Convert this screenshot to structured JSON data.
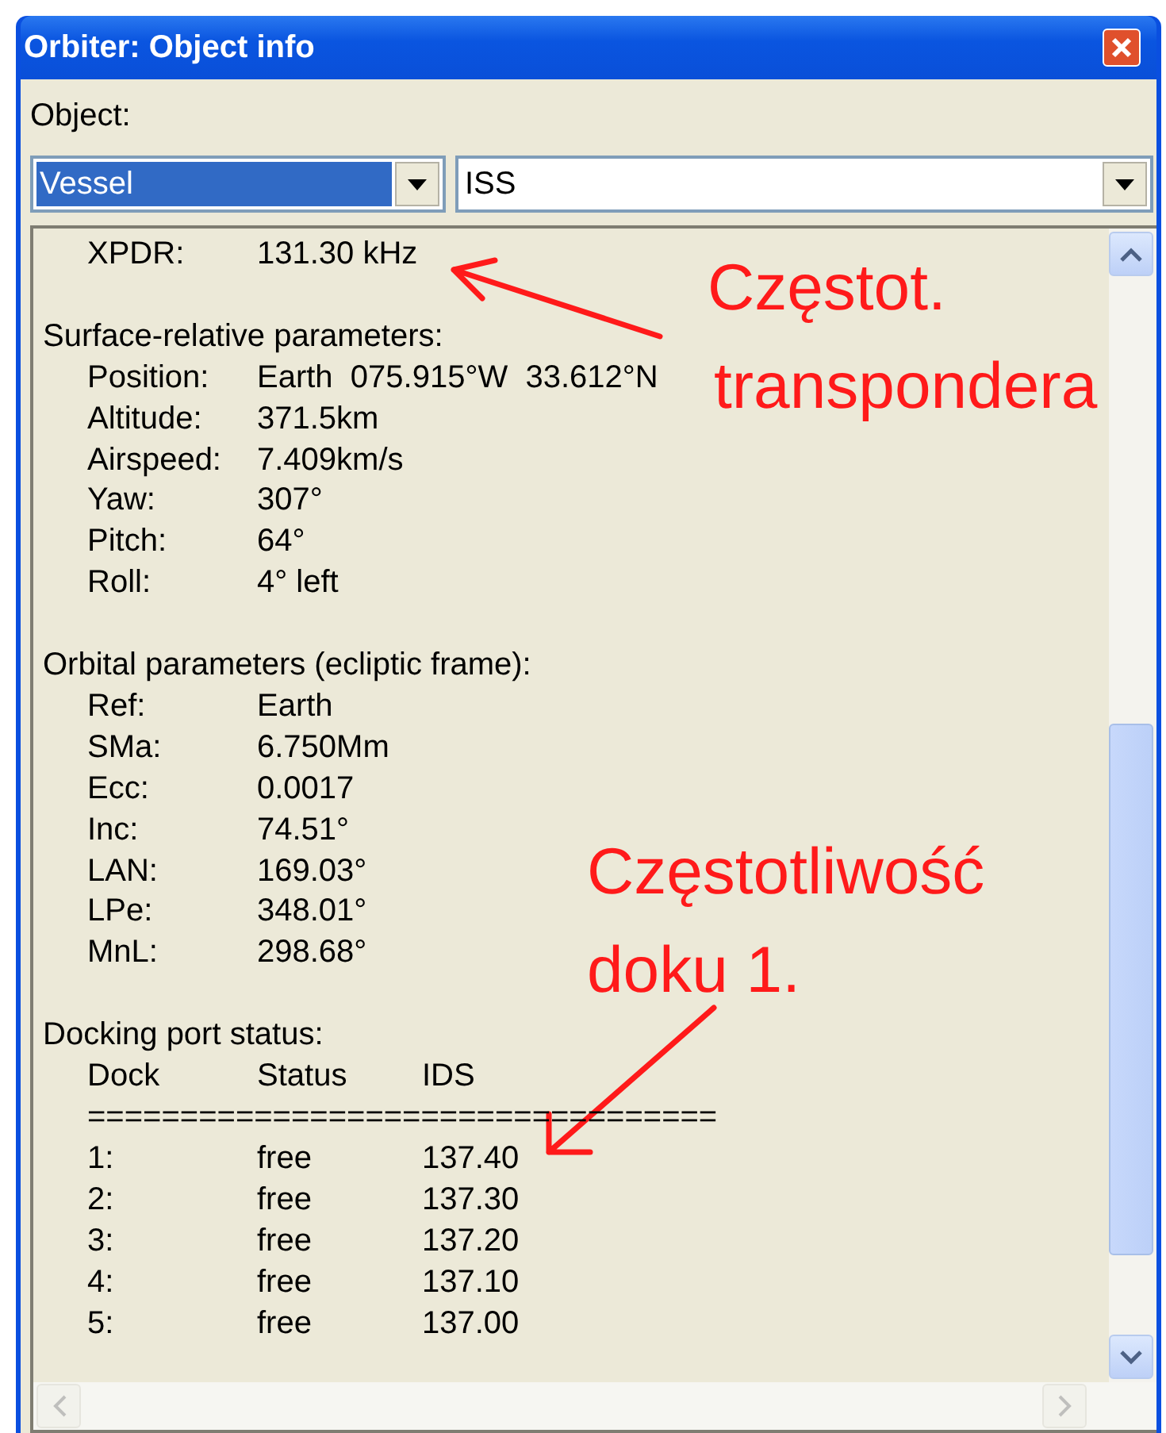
{
  "window": {
    "title": "Orbiter: Object info"
  },
  "object_label": "Object:",
  "type_combo": {
    "value": "Vessel"
  },
  "object_combo": {
    "value": "ISS"
  },
  "info": {
    "top_rows": [
      {
        "label": "XPDR:",
        "value": "131.30 kHz"
      }
    ],
    "sections": [
      {
        "heading": "Surface-relative parameters:",
        "rows": [
          {
            "label": "Position:",
            "value": "Earth  075.915°W  33.612°N"
          },
          {
            "label": "Altitude:",
            "value": "371.5km"
          },
          {
            "label": "Airspeed:",
            "value": "7.409km/s"
          },
          {
            "label": "Yaw:",
            "value": "307°"
          },
          {
            "label": "Pitch:",
            "value": "64°"
          },
          {
            "label": "Roll:",
            "value": "4° left"
          }
        ]
      },
      {
        "heading": "Orbital parameters (ecliptic frame):",
        "rows": [
          {
            "label": "Ref:",
            "value": "Earth"
          },
          {
            "label": "SMa:",
            "value": "6.750Mm"
          },
          {
            "label": "Ecc:",
            "value": "0.0017"
          },
          {
            "label": "Inc:",
            "value": "74.51°"
          },
          {
            "label": "LAN:",
            "value": "169.03°"
          },
          {
            "label": "LPe:",
            "value": "348.01°"
          },
          {
            "label": "MnL:",
            "value": "298.68°"
          }
        ]
      }
    ],
    "docking": {
      "heading": "Docking port status:",
      "columns": [
        "Dock",
        "Status",
        "IDS"
      ],
      "separator": "==================================",
      "rows": [
        {
          "dock": "1:",
          "status": "free",
          "ids": "137.40"
        },
        {
          "dock": "2:",
          "status": "free",
          "ids": "137.30"
        },
        {
          "dock": "3:",
          "status": "free",
          "ids": "137.20"
        },
        {
          "dock": "4:",
          "status": "free",
          "ids": "137.10"
        },
        {
          "dock": "5:",
          "status": "free",
          "ids": "137.00"
        }
      ]
    }
  },
  "annotations": [
    {
      "lines": [
        "Częstot.",
        "transpondera"
      ]
    },
    {
      "lines": [
        "Częstotliwość",
        "doku 1."
      ]
    }
  ]
}
